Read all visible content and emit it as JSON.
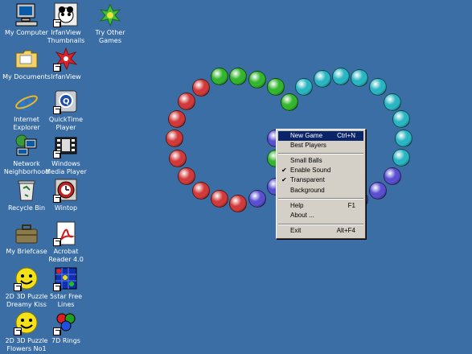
{
  "desktop": {
    "background_color": "#3a6ea5",
    "icons": [
      {
        "label": "My Computer",
        "icon": "computer-icon"
      },
      {
        "label": "IrfanView\nThumbnails",
        "icon": "irfanview-thumbnails-icon"
      },
      {
        "label": "Try Other\nGames",
        "icon": "try-other-games-icon"
      },
      {
        "label": "My Documents",
        "icon": "folder-icon"
      },
      {
        "label": "IrfanView",
        "icon": "irfanview-icon"
      },
      {
        "label": "Internet\nExplorer",
        "icon": "internet-explorer-icon"
      },
      {
        "label": "QuickTime\nPlayer",
        "icon": "quicktime-icon"
      },
      {
        "label": "Network\nNeighborhood",
        "icon": "network-icon"
      },
      {
        "label": "Windows\nMedia Player",
        "icon": "media-player-icon"
      },
      {
        "label": "Recycle Bin",
        "icon": "recycle-bin-icon"
      },
      {
        "label": "Wintop",
        "icon": "wintop-icon"
      },
      {
        "label": "My Briefcase",
        "icon": "briefcase-icon"
      },
      {
        "label": "Acrobat\nReader 4.0",
        "icon": "acrobat-icon"
      },
      {
        "label": "2D 3D Puzzle\nDreamy Kiss",
        "icon": "smiley-icon"
      },
      {
        "label": "5star Free\nLines",
        "icon": "lines-game-icon"
      },
      {
        "label": "2D 3D Puzzle\nFlowers No1",
        "icon": "smiley-icon"
      },
      {
        "label": "7D Rings",
        "icon": "rings-icon"
      }
    ]
  },
  "ball_colors": {
    "red": "#d23a3a",
    "green": "#33b52e",
    "cyan": "#29b5c2",
    "purple": "#5a4fd0"
  },
  "context_menu": {
    "highlight_color": "#0a246a",
    "items": [
      {
        "label": "New Game",
        "accel": "Ctrl+N",
        "checked": false,
        "highlighted": true
      },
      {
        "label": "Best Players",
        "accel": "",
        "checked": false,
        "highlighted": false
      },
      {
        "label": "Small Balls",
        "accel": "",
        "checked": false,
        "highlighted": false
      },
      {
        "label": "Enable Sound",
        "accel": "",
        "checked": true,
        "highlighted": false
      },
      {
        "label": "Transparent",
        "accel": "",
        "checked": true,
        "highlighted": false
      },
      {
        "label": "Background",
        "accel": "",
        "checked": false,
        "highlighted": false
      },
      {
        "label": "Help",
        "accel": "F1",
        "checked": false,
        "highlighted": false
      },
      {
        "label": "About ...",
        "accel": "",
        "checked": false,
        "highlighted": false
      },
      {
        "label": "Exit",
        "accel": "Alt+F4",
        "checked": false,
        "highlighted": false
      }
    ]
  }
}
